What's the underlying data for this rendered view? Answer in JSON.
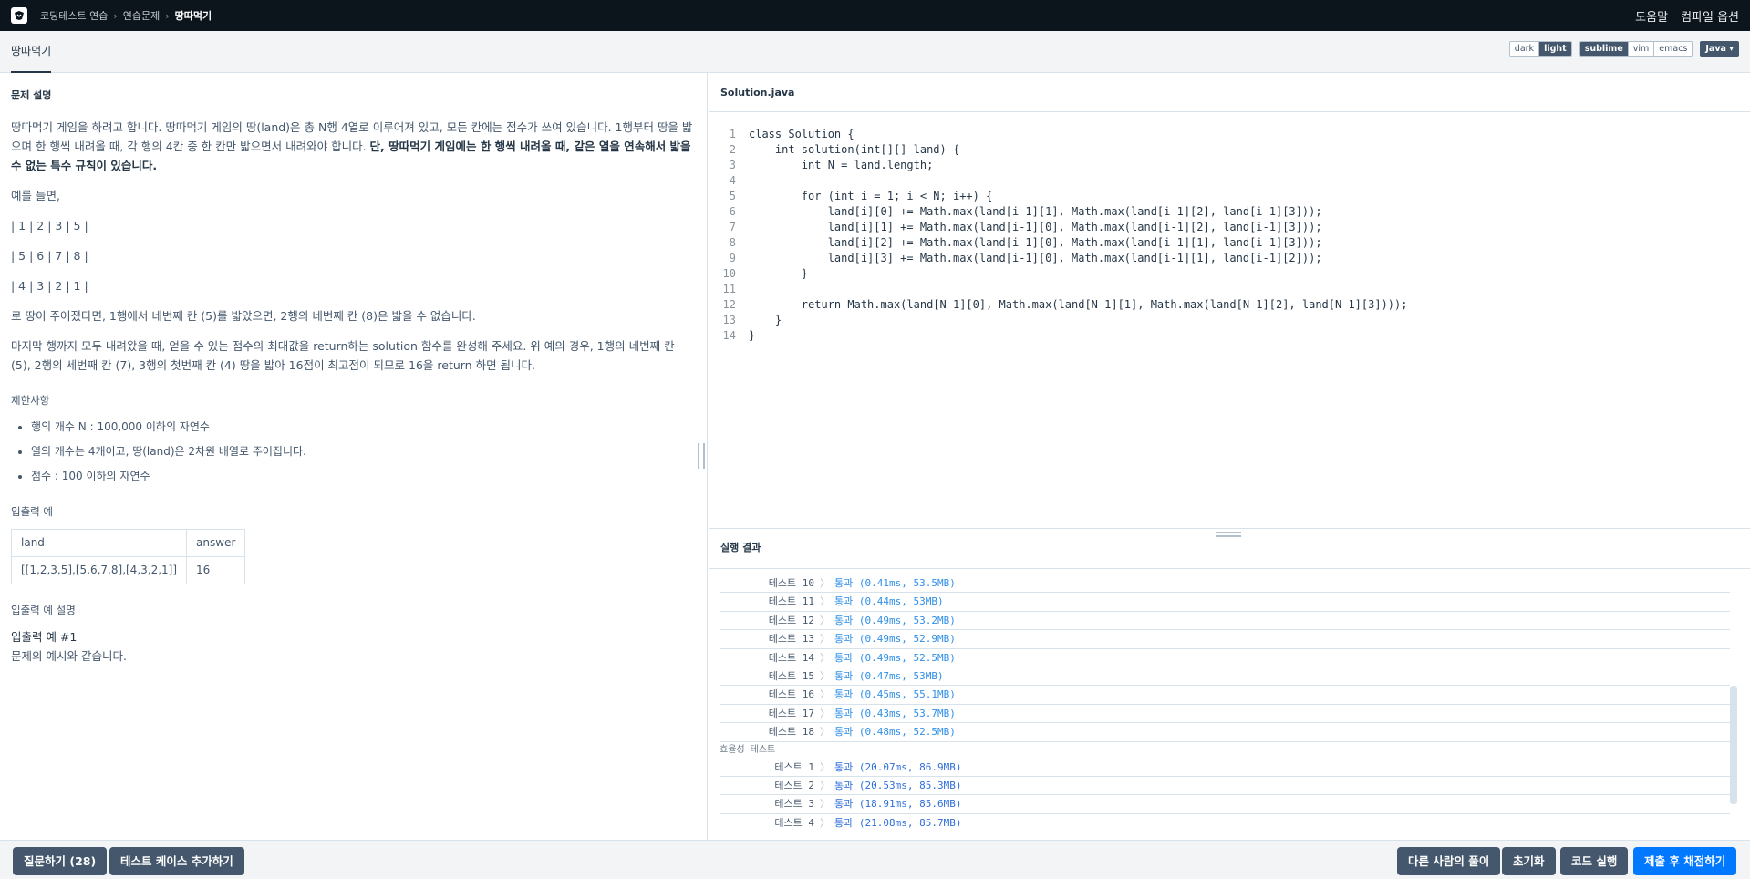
{
  "nav": {
    "breadcrumb": [
      "코딩테스트 연습",
      "연습문제",
      "땅따먹기"
    ],
    "help": "도움말",
    "compile_options": "컴파일 옵션"
  },
  "tab": {
    "title": "땅따먹기"
  },
  "editor_options": {
    "theme": [
      "dark",
      "light"
    ],
    "theme_selected": "light",
    "keymap": [
      "sublime",
      "vim",
      "emacs"
    ],
    "keymap_selected": "sublime",
    "language": "Java ▾"
  },
  "problem": {
    "heading": "문제 설명",
    "para1_plain": "땅따먹기 게임을 하려고 합니다. 땅따먹기 게임의 땅(land)은 총 N행 4열로 이루어져 있고, 모든 칸에는 점수가 쓰여 있습니다. 1행부터 땅을 밟으며 한 행씩 내려올 때, 각 행의 4칸 중 한 칸만 밟으면서 내려와야 합니다. ",
    "para1_bold": "단, 땅따먹기 게임에는 한 행씩 내려올 때, 같은 열을 연속해서 밟을 수 없는 특수 규칙이 있습니다.",
    "example_intro": "예를 들면,",
    "rows": [
      "| 1 | 2 | 3 | 5 |",
      "| 5 | 6 | 7 | 8 |",
      "| 4 | 3 | 2 | 1 |"
    ],
    "para2": "로 땅이 주어졌다면, 1행에서 네번째 칸 (5)를 밟았으면, 2행의 네번째 칸 (8)은 밟을 수 없습니다.",
    "para3": "마지막 행까지 모두 내려왔을 때, 얻을 수 있는 점수의 최대값을 return하는 solution 함수를 완성해 주세요. 위 예의 경우, 1행의 네번째 칸 (5), 2행의 세번째 칸 (7), 3행의 첫번째 칸 (4) 땅을 밟아 16점이 최고점이 되므로 16을 return 하면 됩니다.",
    "constraints_title": "제한사항",
    "constraints": [
      "행의 개수 N : 100,000 이하의 자연수",
      "열의 개수는 4개이고, 땅(land)은 2차원 배열로 주어집니다.",
      "점수 : 100 이하의 자연수"
    ],
    "io_title": "입출력 예",
    "io_headers": [
      "land",
      "answer"
    ],
    "io_rows": [
      [
        "[[1,2,3,5],[5,6,7,8],[4,3,2,1]]",
        "16"
      ]
    ],
    "io_desc_title": "입출력 예 설명",
    "io_ex_title": "입출력 예 #1",
    "io_ex_text": "문제의 예시와 같습니다."
  },
  "code": {
    "filename": "Solution.java",
    "lines": [
      "class Solution {",
      "    int solution(int[][] land) {",
      "        int N = land.length;",
      "",
      "        for (int i = 1; i < N; i++) {",
      "            land[i][0] += Math.max(land[i-1][1], Math.max(land[i-1][2], land[i-1][3]));",
      "            land[i][1] += Math.max(land[i-1][0], Math.max(land[i-1][2], land[i-1][3]));",
      "            land[i][2] += Math.max(land[i-1][0], Math.max(land[i-1][1], land[i-1][3]));",
      "            land[i][3] += Math.max(land[i-1][0], Math.max(land[i-1][1], land[i-1][2]));",
      "        }",
      "",
      "        return Math.max(land[N-1][0], Math.max(land[N-1][1], Math.max(land[N-1][2], land[N-1][3])));",
      "    }",
      "}"
    ]
  },
  "results": {
    "title": "실행 결과",
    "accuracy_tests": [
      {
        "name": "테스트 10",
        "result": "통과 (0.41ms, 53.5MB)"
      },
      {
        "name": "테스트 11",
        "result": "통과 (0.44ms, 53MB)"
      },
      {
        "name": "테스트 12",
        "result": "통과 (0.49ms, 53.2MB)"
      },
      {
        "name": "테스트 13",
        "result": "통과 (0.49ms, 52.9MB)"
      },
      {
        "name": "테스트 14",
        "result": "통과 (0.49ms, 52.5MB)"
      },
      {
        "name": "테스트 15",
        "result": "통과 (0.47ms, 53MB)"
      },
      {
        "name": "테스트 16",
        "result": "통과 (0.45ms, 55.1MB)"
      },
      {
        "name": "테스트 17",
        "result": "통과 (0.43ms, 53.7MB)"
      },
      {
        "name": "테스트 18",
        "result": "통과 (0.48ms, 52.5MB)"
      }
    ],
    "efficiency_label": "효율성  테스트",
    "efficiency_tests": [
      {
        "name": "테스트 1",
        "result": "통과 (20.07ms, 86.9MB)"
      },
      {
        "name": "테스트 2",
        "result": "통과 (20.53ms, 85.3MB)"
      },
      {
        "name": "테스트 3",
        "result": "통과 (18.91ms, 85.6MB)"
      },
      {
        "name": "테스트 4",
        "result": "통과 (21.08ms, 85.7MB)"
      }
    ]
  },
  "buttons": {
    "question": "질문하기 (28)",
    "add_testcase": "테스트 케이스 추가하기",
    "others_solutions": "다른 사람의 풀이",
    "reset": "초기화",
    "run": "코드 실행",
    "submit": "제출 후 채점하기"
  }
}
